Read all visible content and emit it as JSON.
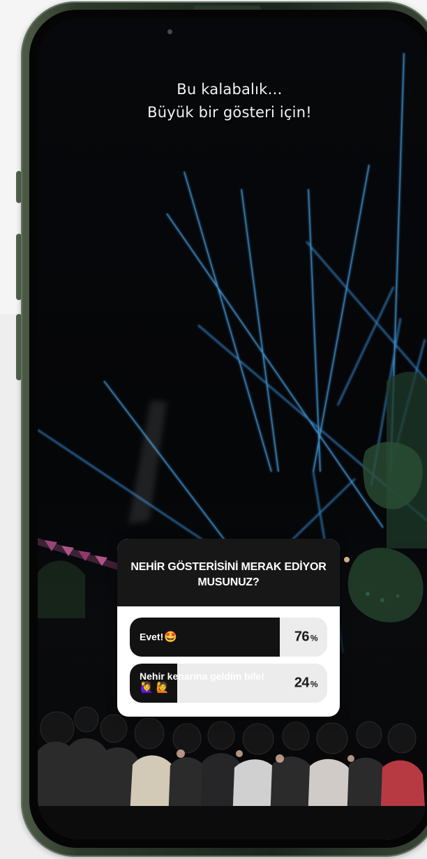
{
  "story": {
    "caption_line_1": "Bu kalabalık…",
    "caption_line_2": "Büyük bir gösteri için!"
  },
  "poll": {
    "question": "NEHİR GÖSTERİSİNİ MERAK EDİYOR MUSUNUZ?",
    "options": [
      {
        "label": "Evet!",
        "emoji": "🤩",
        "percent": "76",
        "percent_sign": "%",
        "fill_fraction": 0.76
      },
      {
        "label": "Nehir kenarına geldim bile!",
        "emoji": "🙋‍♀️ 🙋",
        "percent": "24",
        "percent_sign": "%",
        "fill_fraction": 0.24
      }
    ]
  },
  "colors": {
    "background": "#f5f5f5",
    "phone_frame": "#2d3a2b",
    "screen_night": "#030406",
    "laser_blue": "#3fa9ff",
    "poll_header": "#171717",
    "poll_fill": "#121212",
    "poll_empty": "#ececec"
  },
  "icons": {
    "camera": "camera-dot-icon",
    "emoji_star_eyes": "star-eyes-emoji-icon",
    "emoji_raising_hands": "raising-hand-emoji-icon"
  }
}
